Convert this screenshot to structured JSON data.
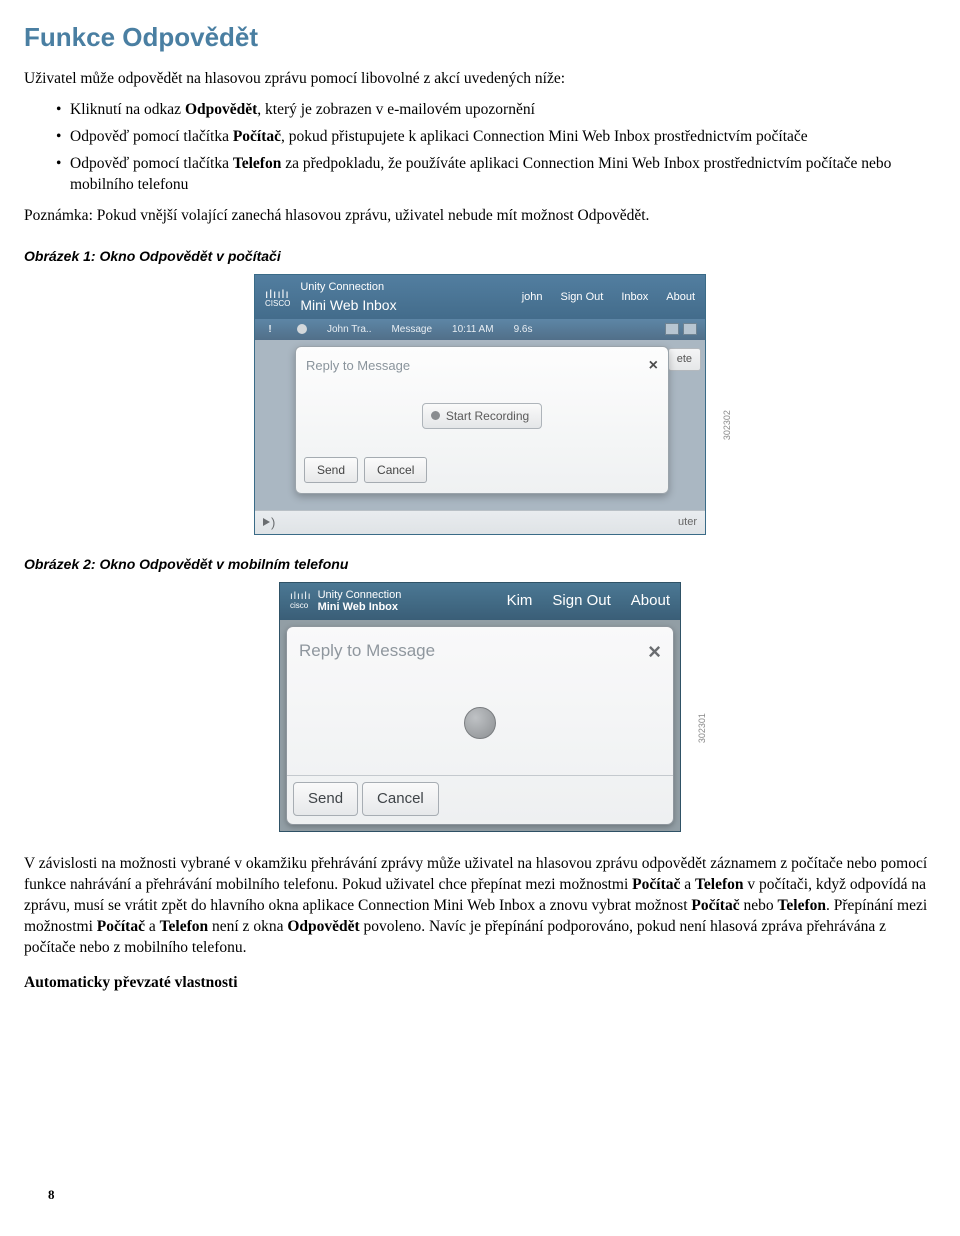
{
  "title": "Funkce Odpovědět",
  "intro": "Uživatel může odpovědět na hlasovou zprávu pomocí libovolné z akcí uvedených níže:",
  "bullets": [
    {
      "type": "mixed",
      "pre": "Kliknutí na odkaz ",
      "bold": "Odpovědět",
      "post": ", který je zobrazen v e-mailovém upozornění"
    },
    {
      "type": "mixed",
      "pre": "Odpověď pomocí tlačítka ",
      "bold": "Počítač",
      "post": ", pokud přistupujete k aplikaci Connection Mini Web Inbox prostřednictvím počítače"
    },
    {
      "type": "mixed",
      "pre": "Odpověď pomocí tlačítka ",
      "bold": "Telefon",
      "post": " za předpokladu, že používáte aplikaci Connection Mini Web Inbox prostřednictvím počítače nebo mobilního telefonu"
    }
  ],
  "note": "Poznámka: Pokud vnější volající zanechá hlasovou zprávu, uživatel nebude mít možnost Odpovědět.",
  "fig1_caption": "Obrázek 1: Okno Odpovědět v počítači",
  "fig2_caption": "Obrázek 2: Okno Odpovědět v mobilním telefonu",
  "paragraph2_parts": {
    "a": "V závislosti na možnosti vybrané v okamžiku přehrávání zprávy může uživatel na hlasovou zprávu odpovědět záznamem z počítače nebo pomocí funkce nahrávání a přehrávání mobilního telefonu. Pokud uživatel chce přepínat mezi možnostmi ",
    "b1": "Počítač",
    "mid1": " a ",
    "b2": "Telefon",
    "c": " v počítači, když odpovídá na zprávu, musí se vrátit zpět do hlavního okna aplikace Connection Mini Web Inbox a znovu vybrat možnost ",
    "b3": "Počítač",
    "mid2": " nebo ",
    "b4": "Telefon",
    "d": ". Přepínání mezi možnostmi ",
    "b5": "Počítač",
    "mid3": " a ",
    "b6": "Telefon",
    "e": " není z okna ",
    "b7": "Odpovědět",
    "f": " povoleno. Navíc je přepínání podporováno, pokud není hlasová zpráva přehrávána z počítače nebo z mobilního telefonu."
  },
  "subheading": "Automaticky převzaté vlastnosti",
  "page_number": "8",
  "fig1": {
    "brand_top": "Unity Connection",
    "brand_sub": "Mini Web Inbox",
    "user": "john",
    "nav": {
      "signout": "Sign Out",
      "inbox": "Inbox",
      "about": "About"
    },
    "row": {
      "from": "John Tra..",
      "col2": "Message",
      "time": "10:11 AM",
      "dur": "9.6s"
    },
    "modal_title": "Reply to Message",
    "record_label": "Start Recording",
    "send": "Send",
    "cancel": "Cancel",
    "back_right": "ete",
    "bottom_right": "uter",
    "side_label": "302302"
  },
  "fig2": {
    "brand_top": "Unity Connection",
    "brand_sub": "Mini Web Inbox",
    "user": "Kim",
    "nav": {
      "signout": "Sign Out",
      "about": "About"
    },
    "modal_title": "Reply to Message",
    "send": "Send",
    "cancel": "Cancel",
    "side_label": "302301"
  }
}
